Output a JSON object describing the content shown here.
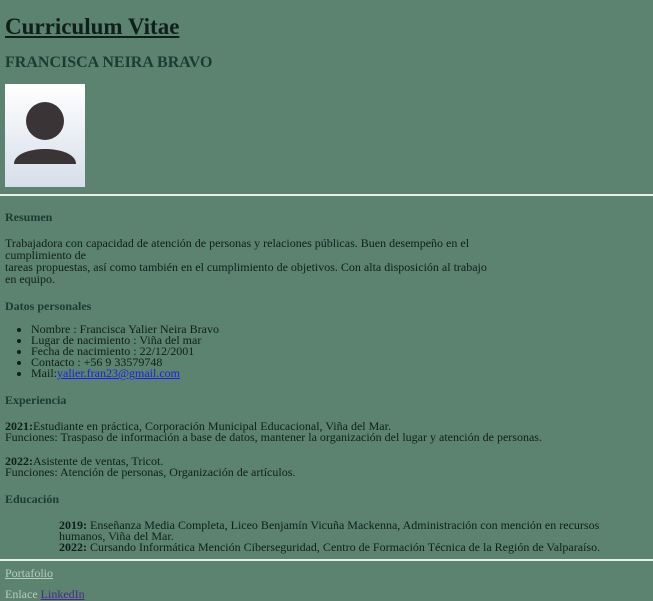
{
  "header": {
    "title": "Curriculum Vitae",
    "name": "FRANCISCA NEIRA BRAVO"
  },
  "summary": {
    "heading": "Resumen",
    "text_line1": "Trabajadora con capacidad de atención de personas y relaciones públicas. Buen desempeño en el cumplimiento de",
    "text_line2": "tareas propuestas, así como también en el cumplimiento de objetivos. Con alta disposición al trabajo en equipo."
  },
  "personal": {
    "heading": "Datos personales",
    "items": [
      "Nombre : Francisca Yalier Neira Bravo",
      "Lugar de nacimiento : Viña del mar",
      "Fecha de nacimiento : 22/12/2001",
      "Contacto : +56 9 33579748"
    ],
    "mail_label": "Mail:",
    "mail_value": "yalier.fran23@gmail.com"
  },
  "experience": {
    "heading": "Experiencia",
    "entries": [
      {
        "year": "2021:",
        "title": "Estudiante en práctica, Corporación Municipal Educacional, Viña del Mar.",
        "functions": "Funciones: Traspaso de información a base de datos, mantener la organización del lugar y atención de personas."
      },
      {
        "year": "2022:",
        "title": "Asistente de ventas, Tricot.",
        "functions": "Funciones: Atención de personas, Organización de artículos."
      }
    ]
  },
  "education": {
    "heading": "Educación",
    "entries": [
      {
        "year": "2019:",
        "text": " Enseñanza Media Completa, Liceo Benjamín Vicuña Mackenna, Administración con mención en recursos humanos, Viña del Mar."
      },
      {
        "year": "2022:",
        "text": " Cursando Informática Mención Ciberseguridad, Centro de Formación Técnica de la Región de Valparaíso."
      }
    ]
  },
  "footer": {
    "portfolio_link": "Portafolio",
    "enlace_label": "Enlace ",
    "linkedin_link": "LinkedIn"
  },
  "colors": {
    "background": "#5c8270",
    "heading": "#1a3d33",
    "mail_link": "#1a22e8",
    "linkedin_link": "#4b2a8c"
  }
}
